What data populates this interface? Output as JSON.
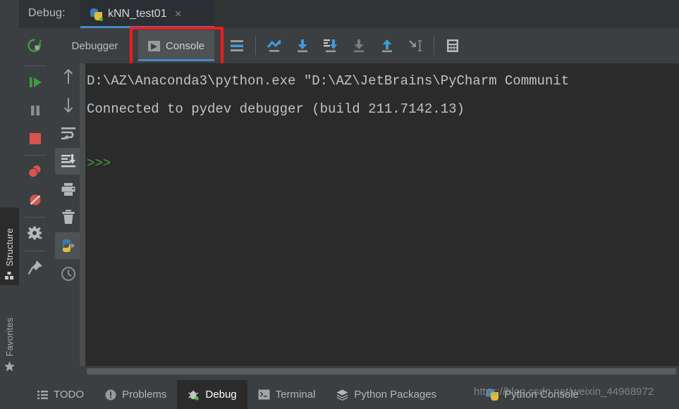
{
  "header": {
    "debug_label": "Debug:",
    "run_tab": {
      "name": "kNN_test01",
      "icon": "python-logo-icon",
      "close": "×"
    }
  },
  "toolbar": {
    "rerun_icon": "rerun-icon",
    "tabs": [
      {
        "label": "Debugger",
        "name": "tab-debugger",
        "selected": false
      },
      {
        "label": "Console",
        "name": "tab-console",
        "selected": true,
        "icon": "console-prompt-icon"
      }
    ],
    "buttons": [
      {
        "name": "mute-breakpoints-icon",
        "title": "Mute Breakpoints"
      },
      {
        "name": "step-over-icon",
        "title": "Step Over"
      },
      {
        "name": "step-into-icon",
        "title": "Step Into"
      },
      {
        "name": "force-step-into-icon",
        "title": "Force Step Into"
      },
      {
        "name": "step-into-my-code-icon",
        "title": "Step Into My Code"
      },
      {
        "name": "step-out-icon",
        "title": "Step Out"
      },
      {
        "name": "run-to-cursor-icon",
        "title": "Run to Cursor"
      },
      {
        "name": "evaluate-expression-icon",
        "title": "Evaluate Expression"
      }
    ]
  },
  "left_bar": {
    "items": [
      {
        "label": "Structure",
        "name": "sidebar-item-structure",
        "icon": "structure-icon",
        "selected": true
      },
      {
        "label": "Favorites",
        "name": "sidebar-item-favorites",
        "icon": "star-icon",
        "selected": false
      }
    ]
  },
  "debug_actions": [
    {
      "name": "rerun-debug-icon",
      "title": "Rerun"
    },
    {
      "name": "resume-program-icon",
      "title": "Resume Program"
    },
    {
      "name": "pause-program-icon",
      "title": "Pause Program"
    },
    {
      "name": "stop-icon",
      "title": "Stop"
    },
    {
      "name": "view-breakpoints-icon",
      "title": "View Breakpoints"
    },
    {
      "name": "mute-breakpoints-toggle-icon",
      "title": "Mute Breakpoints"
    },
    {
      "name": "settings-gear-icon",
      "title": "Settings"
    },
    {
      "name": "pin-tab-icon",
      "title": "Pin Tab"
    }
  ],
  "console_actions": [
    {
      "name": "up-arrow-icon",
      "title": "Previous Occurrence",
      "selected": false
    },
    {
      "name": "down-arrow-icon",
      "title": "Next Occurrence",
      "selected": false
    },
    {
      "name": "soft-wrap-icon",
      "title": "Use Soft Wraps",
      "selected": false
    },
    {
      "name": "scroll-to-end-icon",
      "title": "Scroll to the End",
      "selected": true
    },
    {
      "name": "print-icon",
      "title": "Print",
      "selected": false
    },
    {
      "name": "trash-icon",
      "title": "Clear All",
      "selected": false
    },
    {
      "name": "python-console-icon",
      "title": "Show Python Prompt",
      "selected": true
    },
    {
      "name": "history-clock-icon",
      "title": "Show History",
      "selected": false
    }
  ],
  "console": {
    "lines": [
      {
        "text": "D:\\AZ\\Anaconda3\\python.exe \"D:\\AZ\\JetBrains\\PyCharm Communit",
        "type": "output"
      },
      {
        "text": "Connected to pydev debugger (build 211.7142.13)",
        "type": "output"
      },
      {
        "text": ">>>",
        "type": "prompt"
      }
    ]
  },
  "statusbar": {
    "items": [
      {
        "label": "TODO",
        "name": "status-todo",
        "icon": "list-icon",
        "active": false
      },
      {
        "label": "Problems",
        "name": "status-problems",
        "icon": "warning-icon",
        "active": false
      },
      {
        "label": "Debug",
        "name": "status-debug",
        "icon": "bug-icon",
        "active": true
      },
      {
        "label": "Terminal",
        "name": "status-terminal",
        "icon": "terminal-icon",
        "active": false
      },
      {
        "label": "Python Packages",
        "name": "status-python-packages",
        "icon": "layers-icon",
        "active": false
      }
    ],
    "python_console": {
      "label": "Python Console",
      "icon": "python-logo-icon"
    },
    "watermark": "https://blog.csdn.net/weixin_44968972"
  },
  "colors": {
    "accent_blue": "#4a88c7",
    "annotation_red": "#f21b1b",
    "prompt_green": "#3f9e3f",
    "console_bg": "#2b2b2b",
    "panel_bg": "#3c3f41"
  }
}
